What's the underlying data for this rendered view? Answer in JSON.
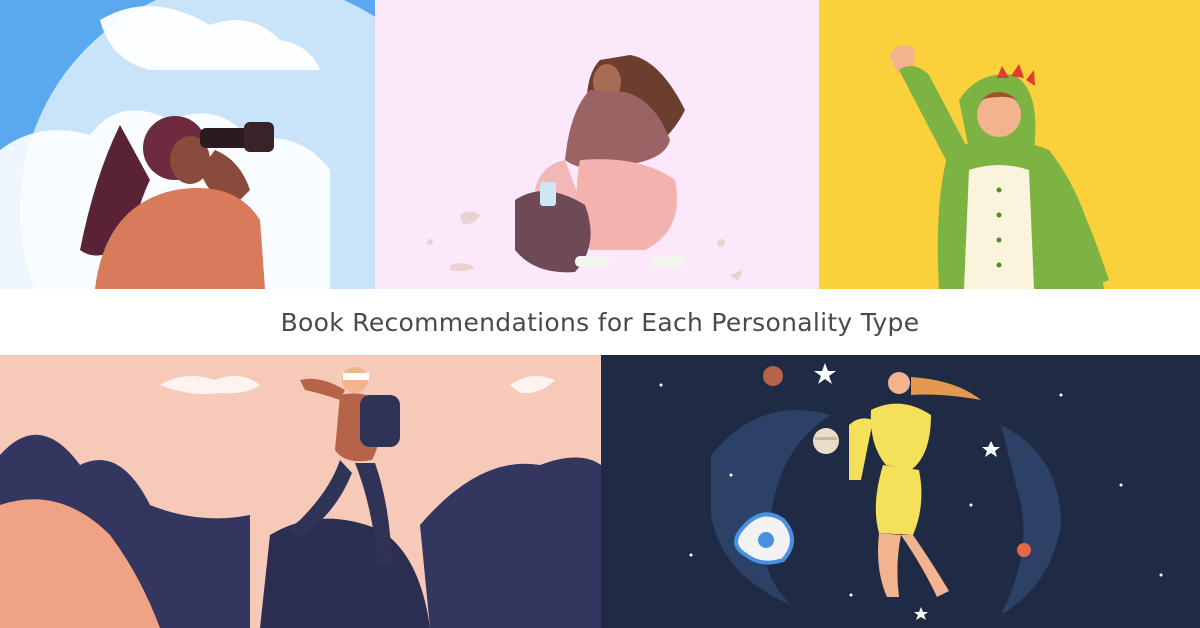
{
  "banner": {
    "title": "Book Recommendations for Each Personality Type"
  },
  "panels": [
    {
      "subject": "woman-with-binoculars",
      "background": "#bfe0f7"
    },
    {
      "subject": "woman-collecting-litter",
      "background": "#fbe9fb"
    },
    {
      "subject": "boy-in-dinosaur-costume-waving",
      "background": "#fbd13b"
    },
    {
      "subject": "hiker-on-mountain",
      "background": "#f6c9b8"
    },
    {
      "subject": "woman-floating-in-space",
      "background": "#1f2b45"
    }
  ],
  "colors": {
    "title_text": "#4a4a4a",
    "band_background": "#ffffff"
  }
}
